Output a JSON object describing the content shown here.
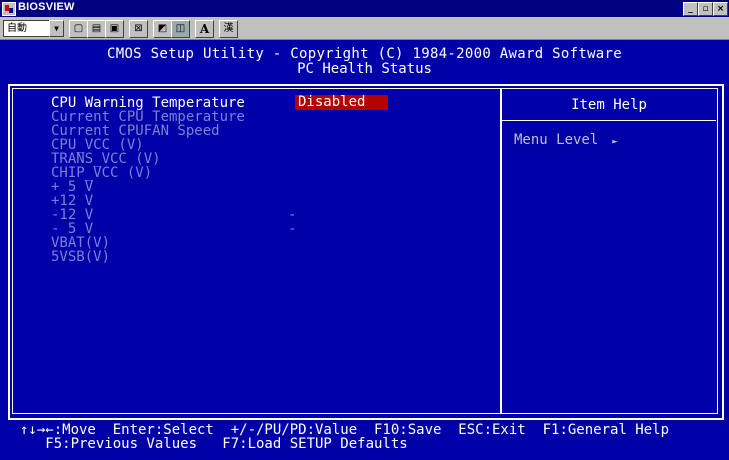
{
  "window": {
    "title": "BIOSVIEW",
    "controls": [
      "_",
      "▫",
      "×"
    ]
  },
  "toolbar": {
    "combo_value": "自動",
    "buttons": [
      "drop",
      "file",
      "copy",
      "paste",
      "fullscreen",
      "font",
      "window",
      "A",
      "漢"
    ]
  },
  "bios": {
    "header_line1": "CMOS Setup Utility - Copyright (C) 1984-2000 Award Software",
    "header_line2": "PC Health Status",
    "items": [
      {
        "label": "CPU Warning Temperature",
        "value": "Disabled"
      },
      {
        "label": "Current CPU Temperature",
        "value": ""
      },
      {
        "label": "Current CPUFAN Speed",
        "value": ""
      },
      {
        "label": "CPU_VCC (V)",
        "value": ""
      },
      {
        "label": "TRANS_VCC (V)",
        "value": ""
      },
      {
        "label": "CHIP_VCC (V)",
        "value": ""
      },
      {
        "label": "+ 5 V",
        "value": ""
      },
      {
        "label": "+12 V",
        "value": ""
      },
      {
        "label": "-12 V",
        "value": "-"
      },
      {
        "label": "- 5 V",
        "value": "-"
      },
      {
        "label": "VBAT(V)",
        "value": ""
      },
      {
        "label": "5VSB(V)",
        "value": ""
      }
    ],
    "help_title": "Item Help",
    "menu_level_label": "Menu Level",
    "menu_level_arrow": "►",
    "footer_line1": "↑↓→←:Move  Enter:Select  +/-/PU/PD:Value  F10:Save  ESC:Exit  F1:General Help",
    "footer_line2": "   F5:Previous Values   F7:Load SETUP Defaults",
    "colors": {
      "background": "#0000a8",
      "selected_value_bg": "#b40000",
      "inactive_text": "#7f7fd6"
    }
  }
}
